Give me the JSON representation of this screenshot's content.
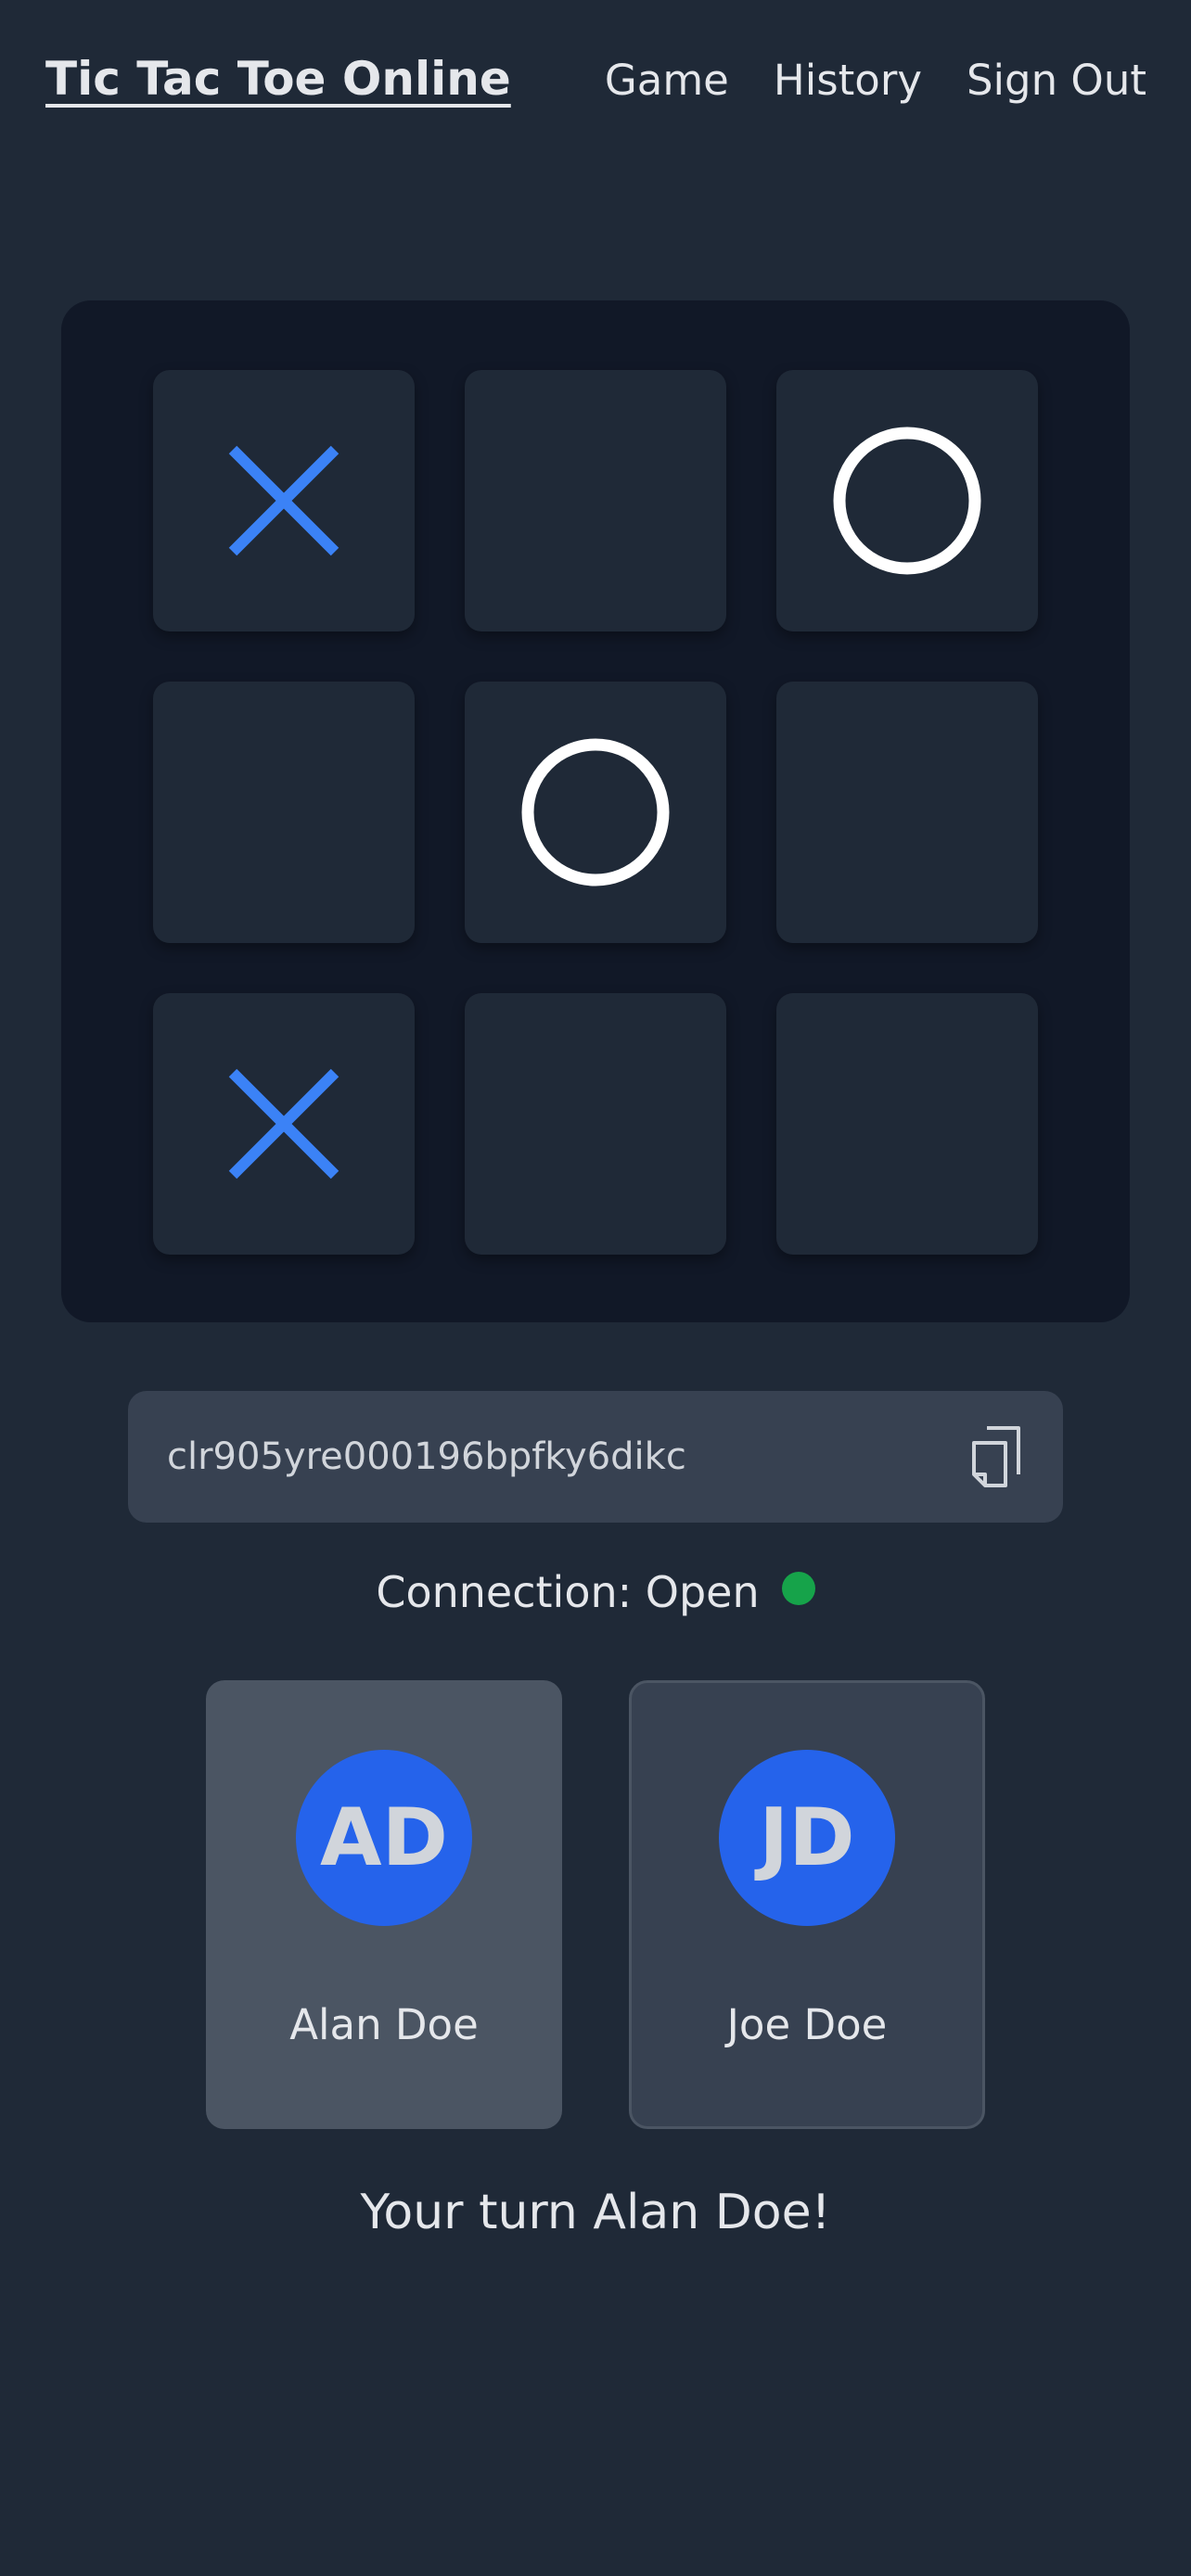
{
  "header": {
    "brand": "Tic Tac Toe Online",
    "nav": [
      "Game",
      "History",
      "Sign Out"
    ]
  },
  "board": {
    "cells": [
      "X",
      "",
      "O",
      "",
      "O",
      "",
      "X",
      "",
      ""
    ],
    "x_color": "#3b82f6",
    "o_color": "#ffffff"
  },
  "game_id": {
    "value": "clr905yre000196bpfky6dikc",
    "copy_icon": "copy-icon"
  },
  "connection": {
    "label": "Connection: Open",
    "status_color": "#16a34a"
  },
  "players": [
    {
      "initials": "AD",
      "name": "Alan Doe",
      "active": true
    },
    {
      "initials": "JD",
      "name": "Joe Doe",
      "active": false
    }
  ],
  "status": "Your turn Alan Doe!",
  "colors": {
    "background": "#1f2937",
    "board": "#111827",
    "avatar": "#2563eb"
  }
}
